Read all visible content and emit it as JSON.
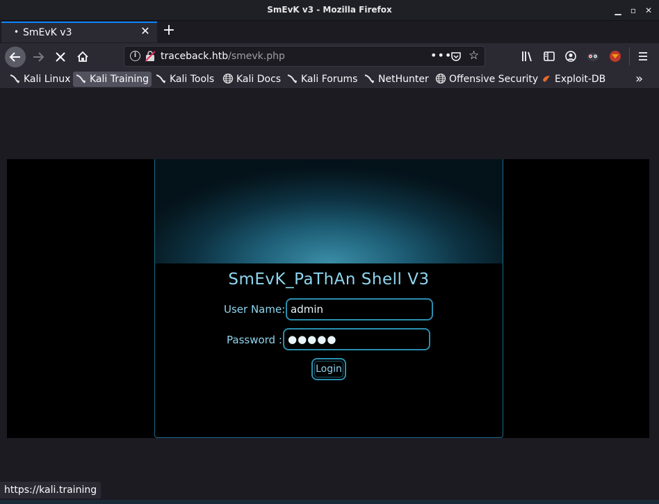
{
  "window": {
    "title": "SmEvK v3 - Mozilla Firefox"
  },
  "tab": {
    "label": "SmEvK v3"
  },
  "urlbar": {
    "host": "traceback.htb",
    "path": "/smevk.php"
  },
  "bookmarks": [
    {
      "label": "Kali Linux",
      "icon": "kali-dragon-icon"
    },
    {
      "label": "Kali Training",
      "icon": "kali-dragon-icon"
    },
    {
      "label": "Kali Tools",
      "icon": "kali-dragon-icon"
    },
    {
      "label": "Kali Docs",
      "icon": "globe-icon"
    },
    {
      "label": "Kali Forums",
      "icon": "kali-dragon-icon"
    },
    {
      "label": "NetHunter",
      "icon": "kali-dragon-icon"
    },
    {
      "label": "Offensive Security",
      "icon": "globe-icon"
    },
    {
      "label": "Exploit-DB",
      "icon": "exploit-db-icon"
    }
  ],
  "shell": {
    "title": "SmEvK_PaThAn Shell V3",
    "username_label": "User Name:",
    "username_value": "admin",
    "password_label": "Password :",
    "password_masked": "●●●●●",
    "login_label": "Login"
  },
  "statusbar": {
    "link": "https://kali.training"
  },
  "colors": {
    "accent": "#0a84ff",
    "shell_text": "#8ed6ef",
    "shell_border": "#2a8fb0"
  }
}
